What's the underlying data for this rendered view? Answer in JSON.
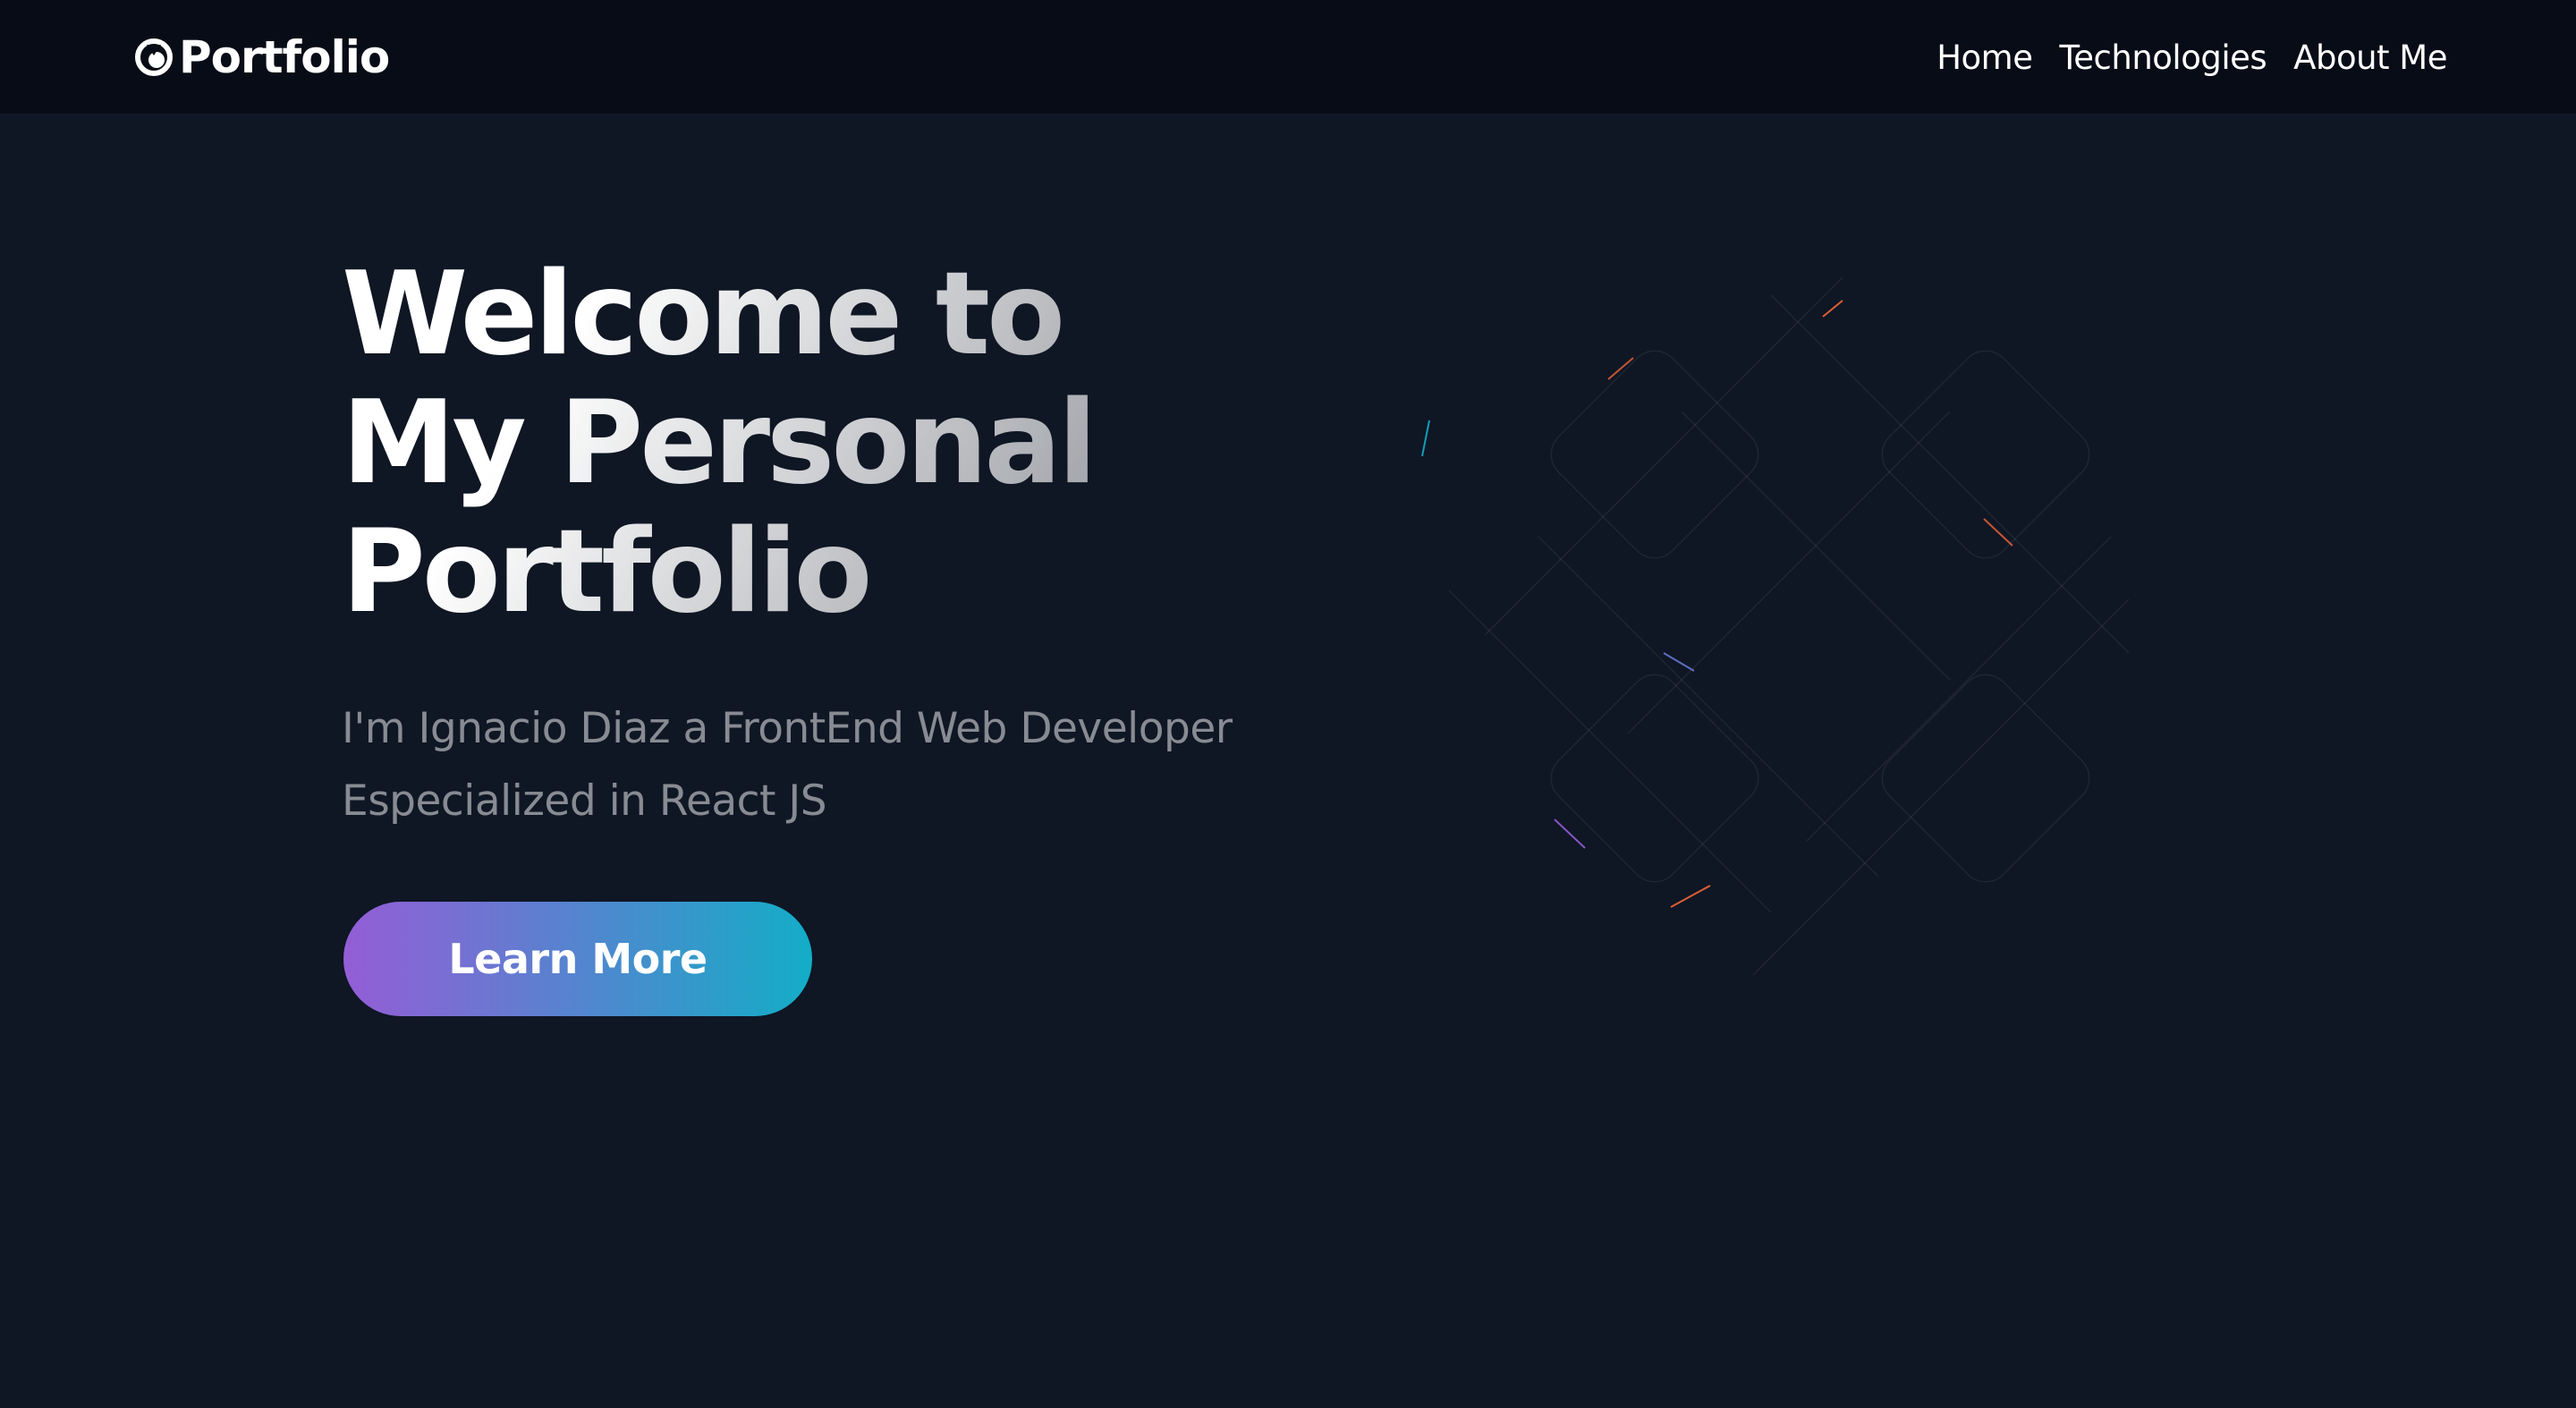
{
  "navbar": {
    "brand": {
      "icon": "camera-aperture-icon",
      "label": "Portfolio"
    },
    "links": [
      {
        "label": "Home"
      },
      {
        "label": "Technologies"
      },
      {
        "label": "About Me"
      }
    ]
  },
  "hero": {
    "title_lines": [
      "Welcome to",
      "My Personal",
      "Portfolio"
    ],
    "subtitle_lines": [
      "I'm Ignacio Diaz a FrontEnd Web Developer",
      "Especialized in React JS"
    ],
    "cta_label": "Learn More"
  },
  "colors": {
    "background": "#0f1624",
    "navbar": "#080c16",
    "button_gradient": [
      "#945dd6",
      "#6978d1",
      "#13adc7"
    ],
    "accent_orange": "#f46737",
    "accent_blue": "#13adc7",
    "accent_purple": "#945dd6"
  }
}
